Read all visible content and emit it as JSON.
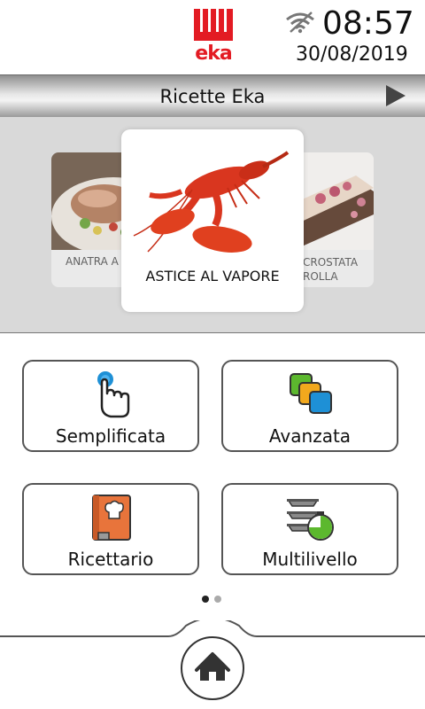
{
  "status": {
    "brand": "eka",
    "time": "08:57",
    "date": "30/08/2019",
    "wifi_icon": "wifi-off-icon"
  },
  "header": {
    "title": "Ricette Eka",
    "next_icon": "play-arrow-icon"
  },
  "carousel": {
    "items": [
      {
        "label": "ANATRA A",
        "image": "duck-dish-image"
      },
      {
        "label": "ASTICE AL VAPORE",
        "image": "lobster-image"
      },
      {
        "label_line1": "CROSTATA",
        "label_line2": "ROLLA",
        "image": "tart-image"
      }
    ]
  },
  "modes": {
    "semplificata": "Semplificata",
    "avanzata": "Avanzata",
    "ricettario": "Ricettario",
    "multilivello": "Multilivello"
  },
  "pagination": {
    "total": 2,
    "active": 1
  },
  "colors": {
    "brand_red": "#e31b23",
    "accent_blue": "#1e90d6",
    "accent_green": "#5cb82e",
    "accent_orange": "#e8743b"
  }
}
